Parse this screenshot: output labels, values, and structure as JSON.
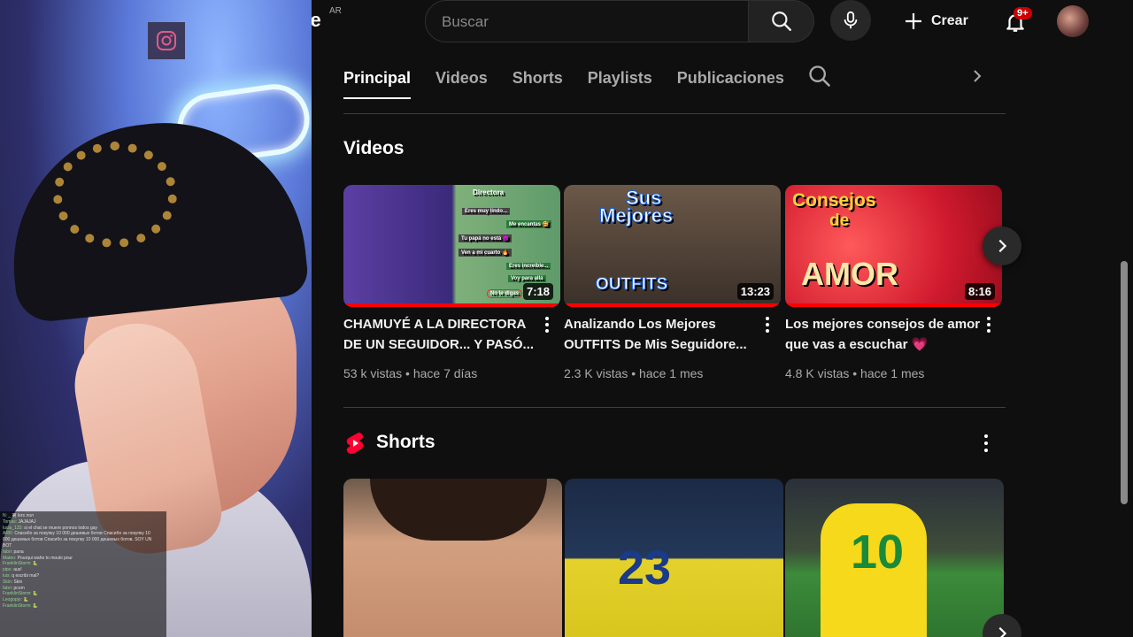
{
  "webcam": {
    "chat_lines": [
      {
        "user": "N:",
        "text": "_ 第 lors лол"
      },
      {
        "user": "Tomas:",
        "text": "JAJAJAJ"
      },
      {
        "user": "lucia_133:",
        "text": "si el chat se muere ponnos todos gay"
      },
      {
        "user": "ARR:",
        "text": "Спасибо за покупку 10 000 дешевых ботов Спасибо за покупку 10"
      },
      {
        "user": "",
        "text": "000 дешевых ботов Спасибо за покупку 10 000 дешевых ботов. SOY UN"
      },
      {
        "user": "",
        "text": "BOT"
      },
      {
        "user": "fabri:",
        "text": "pana"
      },
      {
        "user": "Mateo:",
        "text": "Pourqui waho to mouki pour"
      },
      {
        "user": "FranklinStorm:",
        "text": "🐍"
      },
      {
        "user": "pipo:",
        "text": "aus!"
      },
      {
        "user": "luis:",
        "text": "q escribi mal?"
      },
      {
        "user": "Skin:",
        "text": "Skin"
      },
      {
        "user": "fabri:",
        "text": "pcom"
      },
      {
        "user": "FranklinStorm:",
        "text": "🐍"
      },
      {
        "user": "Leogopjo:",
        "text": "🐍"
      },
      {
        "user": "FranklinStorm:",
        "text": "🐍"
      }
    ]
  },
  "topbar": {
    "logo_fragment": "be",
    "country_code": "AR",
    "search_placeholder": "Buscar",
    "create_label": "Crear",
    "notification_badge": "9+"
  },
  "tabs": [
    {
      "label": "Principal",
      "active": true
    },
    {
      "label": "Videos",
      "active": false
    },
    {
      "label": "Shorts",
      "active": false
    },
    {
      "label": "Playlists",
      "active": false
    },
    {
      "label": "Publicaciones",
      "active": false
    }
  ],
  "videos_section": {
    "title": "Videos",
    "items": [
      {
        "title": "CHAMUYÉ A LA DIRECTORA DE UN SEGUIDOR... Y PASÓ...",
        "meta": "53 k vistas • hace 7 días",
        "duration": "7:18",
        "thumb_texts": [
          "Directora",
          "Eres muy lindo...",
          "Me encantas 🥰",
          "Tu papá no está 😈",
          "Ven a mi cuarto 🔥",
          "Eres increíble...",
          "Voy para allá",
          "No le digas"
        ]
      },
      {
        "title": "Analizando Los Mejores OUTFITS De Mis Seguidore...",
        "meta": "2.3 K vistas • hace 1 mes",
        "duration": "13:23",
        "thumb_texts": [
          "Sus",
          "Mejores",
          "OUTFITS"
        ]
      },
      {
        "title": "Los mejores consejos de amor que vas a escuchar 💗",
        "meta": "4.8 K vistas • hace 1 mes",
        "duration": "8:16",
        "thumb_texts": [
          "Consejos",
          "de",
          "AMOR"
        ]
      }
    ]
  },
  "shorts_section": {
    "title": "Shorts",
    "items": [
      {
        "thumb_text": ""
      },
      {
        "thumb_text": "23"
      },
      {
        "thumb_text": "10"
      }
    ]
  },
  "colors": {
    "background": "#0f0f0f",
    "accent_red": "#ff0000",
    "text_primary": "#f1f1f1",
    "text_secondary": "#aaaaaa"
  }
}
